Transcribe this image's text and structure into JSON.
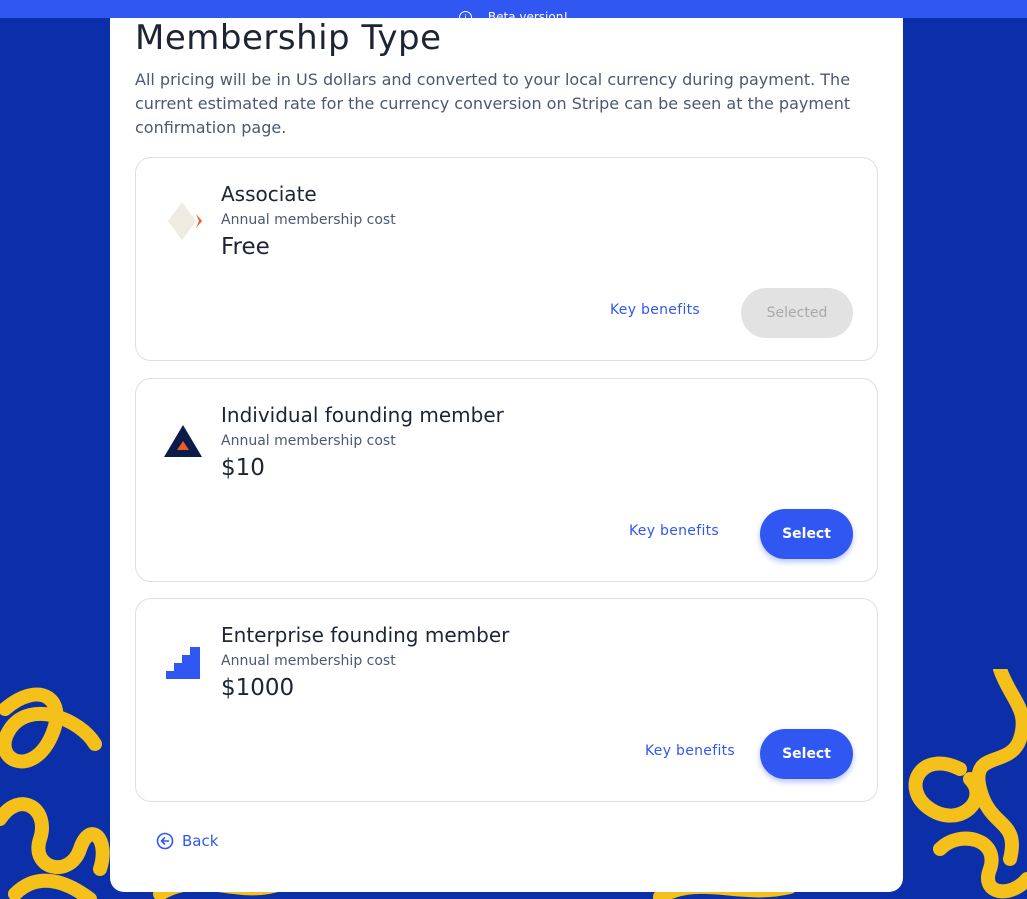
{
  "beta_banner": {
    "text": "Beta version!",
    "icon": "info-icon"
  },
  "page": {
    "title": "Membership Type",
    "intro": "All pricing will be in US dollars and converted to your local currency during payment. The current estimated rate for the currency conversion on Stripe can be seen at the payment confirmation page."
  },
  "cards": [
    {
      "title": "Associate",
      "cost_label": "Annual membership cost",
      "price": "Free",
      "benefits_label": "Key benefits",
      "button_label": "Selected",
      "selected": true,
      "icon": "associate-diamond-icon"
    },
    {
      "title": "Individual founding member",
      "cost_label": "Annual membership cost",
      "price": "$10",
      "benefits_label": "Key benefits",
      "button_label": "Select",
      "selected": false,
      "icon": "triangle-icon"
    },
    {
      "title": "Enterprise founding member",
      "cost_label": "Annual membership cost",
      "price": "$1000",
      "benefits_label": "Key benefits",
      "button_label": "Select",
      "selected": false,
      "icon": "stairs-icon"
    }
  ],
  "back": {
    "label": "Back",
    "icon": "arrow-left-circle-icon"
  },
  "colors": {
    "background": "#0a2fa8",
    "accent": "#3057f2",
    "squiggle": "#f6c01a",
    "icon_orange": "#f05a22",
    "icon_navy": "#0b1b4a"
  }
}
